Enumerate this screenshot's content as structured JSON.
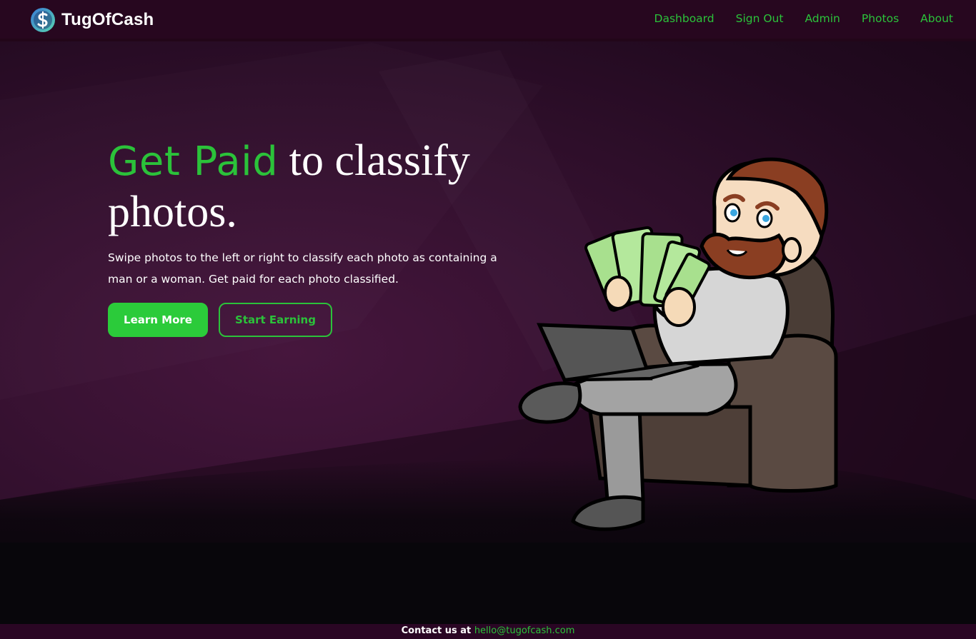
{
  "brand": {
    "name": "TugOfCash",
    "logo_icon": "dollar-coin-icon"
  },
  "nav": {
    "items": [
      {
        "label": "Dashboard"
      },
      {
        "label": "Sign Out"
      },
      {
        "label": "Admin"
      },
      {
        "label": "Photos"
      },
      {
        "label": "About"
      }
    ]
  },
  "hero": {
    "headline_accent": "Get Paid",
    "headline_rest": "to classify photos.",
    "subtitle": "Swipe photos to the left or right to classify each photo as containing a man or a woman. Get paid for each photo classified.",
    "primary_button": "Learn More",
    "secondary_button": "Start Earning"
  },
  "illustration": {
    "icon": "man-with-cash-in-armchair-illustration"
  },
  "footer": {
    "contact_prefix": "Contact us at",
    "email": "hello@tugofcash.com"
  },
  "colors": {
    "accent": "#2bc23a",
    "nav_bg": "#27071f",
    "hero_bg": "#33102e",
    "bottom_bg": "#0a060c"
  }
}
